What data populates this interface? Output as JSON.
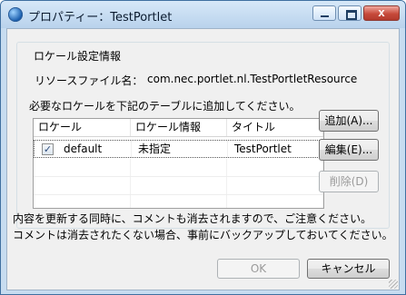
{
  "window": {
    "title": "プロパティー：TestPortlet",
    "controls": {
      "minimize": "",
      "maximize": "",
      "close": "x"
    }
  },
  "group": {
    "legend": "ロケール設定情報",
    "resource_label": "リソースファイル名：",
    "resource_value": "com.nec.portlet.nl.TestPortletResource",
    "instruction": "必要なロケールを下記のテーブルに追加してください。"
  },
  "table": {
    "columns": [
      "ロケール",
      "ロケール情報",
      "タイトル"
    ],
    "rows": [
      {
        "checked": true,
        "check_mark": "✓",
        "cells": [
          "default",
          "未指定",
          "TestPortlet"
        ]
      }
    ]
  },
  "side_buttons": {
    "add": "追加(A)...",
    "edit": "編集(E)...",
    "delete": "削除(D)"
  },
  "notice": {
    "line1": "内容を更新する同時に、コメントも消去されますので、ご注意ください。",
    "line2": "コメントは消去されたくない場合、事前にバックアップしておいてください。"
  },
  "footer": {
    "ok": "OK",
    "cancel": "キャンセル"
  }
}
